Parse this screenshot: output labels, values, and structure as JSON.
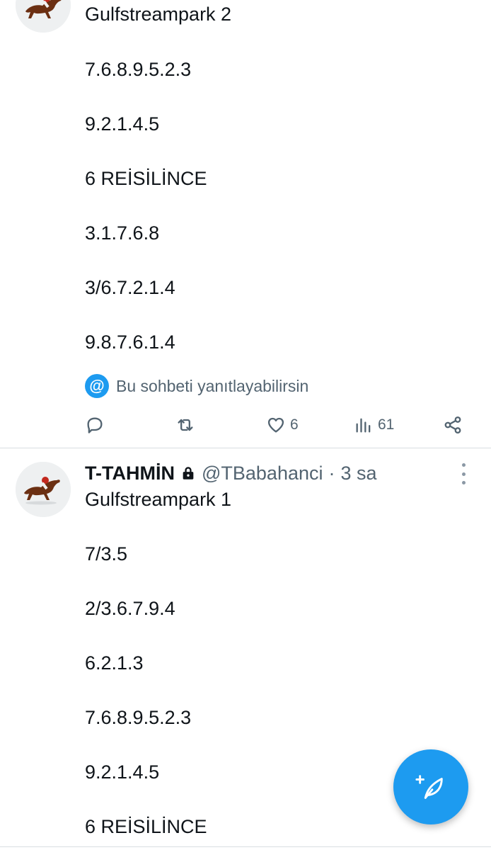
{
  "tweet1": {
    "lines": [
      "Gulfstreampark 2",
      "7.6.8.9.5.2.3",
      "9.2.1.4.5",
      "6 REİSİLİNCE",
      "3.1.7.6.8",
      "3/6.7.2.1.4",
      "9.8.7.6.1.4"
    ],
    "reply_note": "Bu sohbeti yanıtlayabilirsin",
    "actions": {
      "likes": "6",
      "views": "61"
    }
  },
  "tweet2": {
    "author": "T-TAHMİN",
    "handle": "@TBabahanci",
    "separator": "·",
    "time": "3 sa",
    "lines": [
      "Gulfstreampark 1",
      "7/3.5",
      "2/3.6.7.9.4",
      "6.2.1.3",
      "7.6.8.9.5.2.3",
      "9.2.1.4.5",
      "6 REİSİLİNCE"
    ]
  },
  "icons": {
    "reply": "reply-icon",
    "retweet": "retweet-icon",
    "like": "heart-icon",
    "views": "views-icon",
    "share": "share-icon",
    "lock": "lock-icon",
    "more": "more-icon",
    "compose": "compose-icon"
  },
  "colors": {
    "accent": "#1d9bf0",
    "secondary_text": "#536471",
    "text": "#0f1419"
  }
}
